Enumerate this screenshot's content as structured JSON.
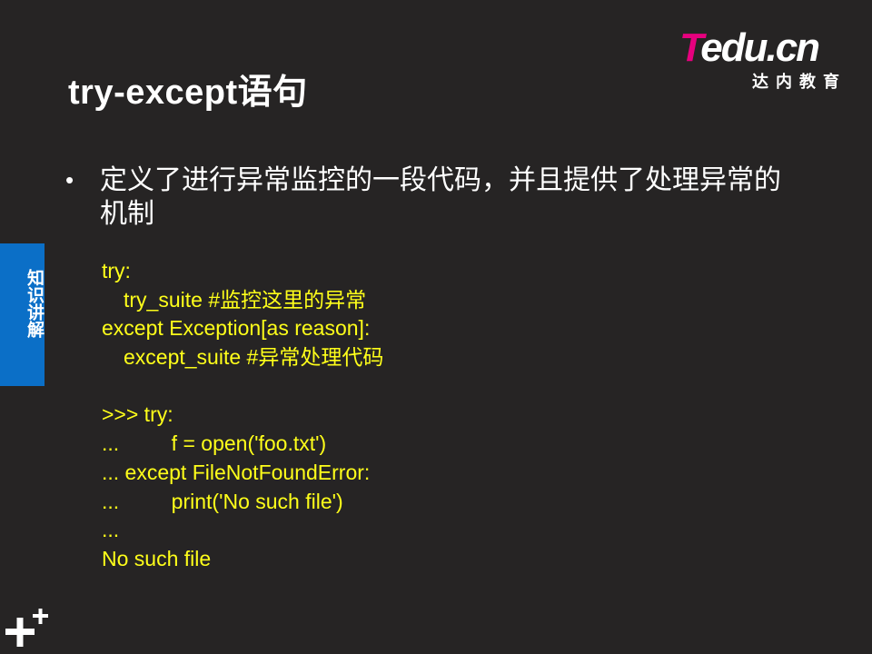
{
  "slide": {
    "title": "try-except语句",
    "logo": {
      "word_t": "T",
      "word_rest": "edu",
      "word_cn": ".cn",
      "subtitle": "达内教育",
      "colors": {
        "pink": "#e6007e",
        "white": "#ffffff"
      }
    },
    "bullet": {
      "marker": "•",
      "text": "定义了进行异常监控的一段代码，并且提供了处理异常的机制"
    },
    "side_tab": {
      "label": "知识讲解",
      "color": "#0b6fc7"
    },
    "code_lines": [
      {
        "text": "try:",
        "indent": false
      },
      {
        "text": "try_suite #监控这里的异常",
        "indent": true
      },
      {
        "text": "except Exception[as reason]:",
        "indent": false
      },
      {
        "text": "except_suite #异常处理代码",
        "indent": true
      },
      {
        "text": "",
        "indent": false
      },
      {
        "text": ">>> try:",
        "indent": false
      },
      {
        "text": "...         f = open('foo.txt')",
        "indent": false
      },
      {
        "text": "... except FileNotFoundError:",
        "indent": false
      },
      {
        "text": "...         print('No such file')",
        "indent": false
      },
      {
        "text": "...",
        "indent": false
      },
      {
        "text": "No such file",
        "indent": false
      }
    ],
    "colors": {
      "background": "#262424",
      "code": "#ffff1a",
      "text": "#ffffff"
    },
    "icons": {
      "corner": "plus-icon"
    }
  }
}
